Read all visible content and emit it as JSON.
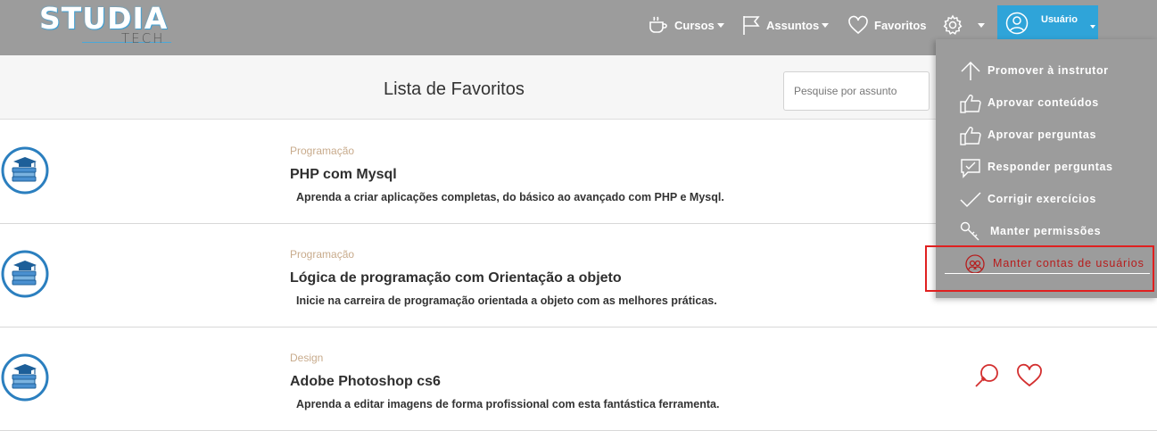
{
  "header": {
    "logo_main": "STUDIA",
    "logo_sub": "TECH",
    "nav": [
      {
        "label": "Cursos",
        "icon": "coffee-cup-icon"
      },
      {
        "label": "Assuntos",
        "icon": "flag-icon"
      },
      {
        "label": "Favoritos",
        "icon": "heart-icon"
      }
    ],
    "settings_icon": "gear-icon",
    "user_label": "Usuário"
  },
  "subheader": {
    "title": "Lista de Favoritos",
    "search_placeholder": "Pesquise por assunto"
  },
  "courses": [
    {
      "category": "Programação",
      "title": "PHP com Mysql",
      "description": "Aprenda a criar aplicações completas, do básico ao avançado com PHP e Mysql."
    },
    {
      "category": "Programação",
      "title": "Lógica de programação com Orientação a objeto",
      "description": "Inicie na carreira de programação orientada a objeto com as melhores práticas."
    },
    {
      "category": "Design",
      "title": "Adobe Photoshop cs6",
      "description": "Aprenda a editar imagens de forma profissional com esta fantástica ferramenta."
    }
  ],
  "menu": {
    "items": [
      {
        "label": "Promover à instrutor",
        "icon": "arrow-up-icon"
      },
      {
        "label": "Aprovar conteúdos",
        "icon": "thumbs-up-icon"
      },
      {
        "label": "Aprovar perguntas",
        "icon": "thumbs-up-icon"
      },
      {
        "label": "Responder perguntas",
        "icon": "chat-check-icon"
      },
      {
        "label": "Corrigir exercícios",
        "icon": "check-icon"
      },
      {
        "label": "Manter permissões",
        "icon": "wrench-icon"
      },
      {
        "label": "Manter contas de usuários",
        "icon": "users-icon"
      }
    ],
    "active_index": 6
  },
  "colors": {
    "header_bg": "#9c9c9c",
    "accent_blue": "#2fa4d9",
    "category_tan": "#c8ab8c",
    "action_red": "#d32f2f",
    "highlight_red": "#e02020"
  }
}
